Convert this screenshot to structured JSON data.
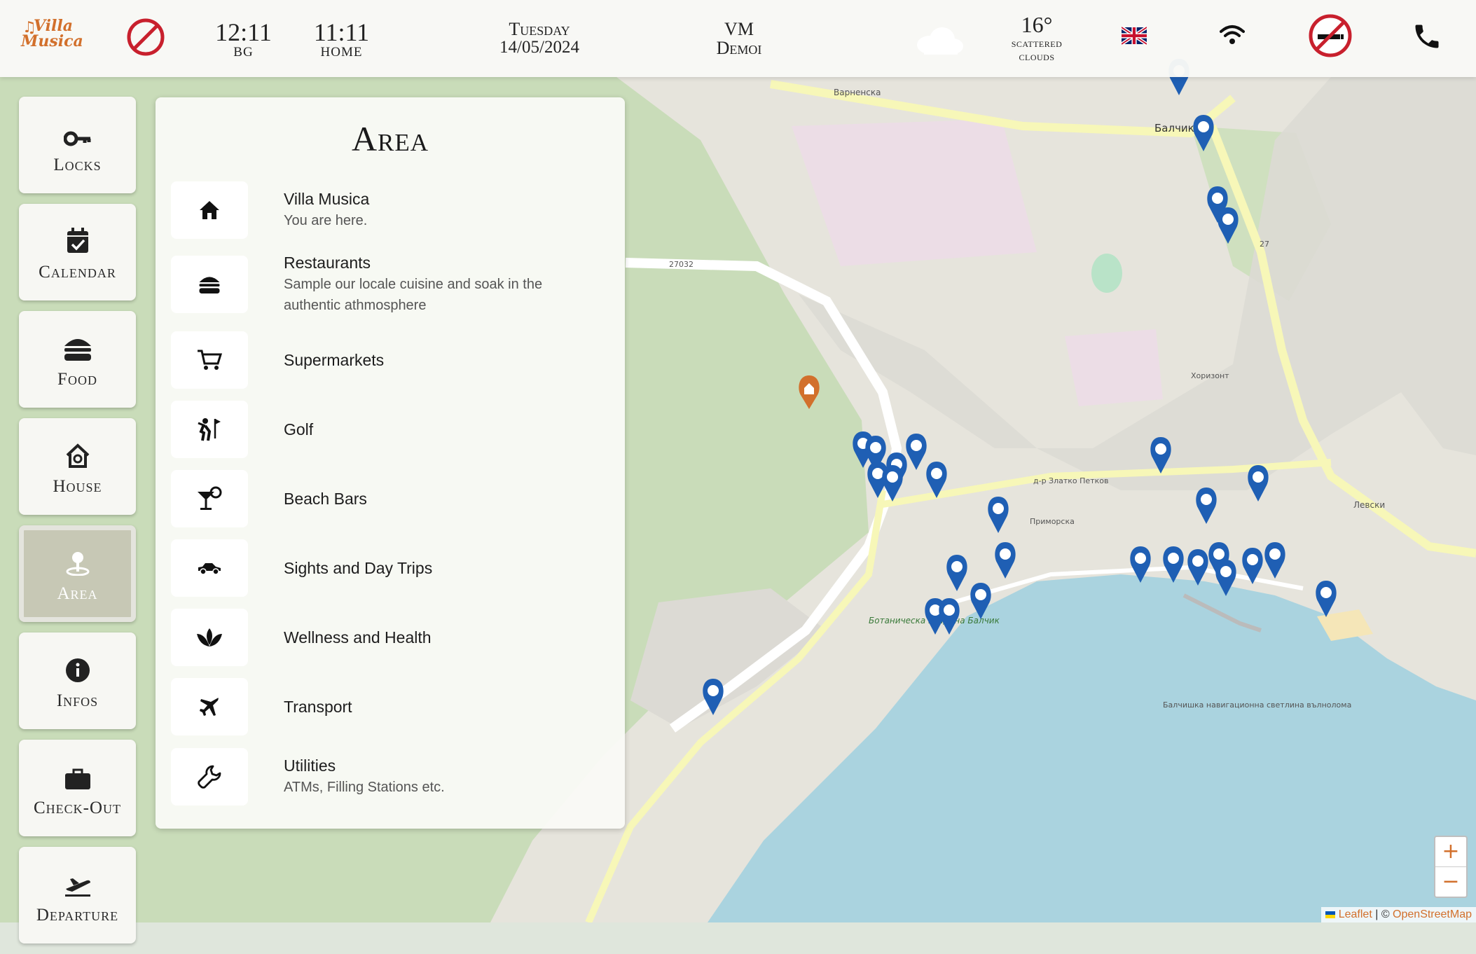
{
  "header": {
    "logo_line1": "Villa",
    "logo_line2": "Musica",
    "time_bg": "12:11",
    "time_bg_label": "BG",
    "time_home": "11:11",
    "time_home_label": "HOME",
    "day": "Tuesday",
    "date": "14/05/2024",
    "guest_line1": "VM",
    "guest_line2": "Demoi",
    "temperature": "16°",
    "weather_line1": "scattered",
    "weather_line2": "clouds",
    "icons": [
      "no-entry-icon",
      "cloud-icon",
      "uk-flag-icon",
      "wifi-icon",
      "no-smoking-icon",
      "phone-icon"
    ],
    "accent": "#d2702c",
    "alert_red": "#c8202d"
  },
  "sidebar": {
    "items": [
      {
        "label": "Locks",
        "icon": "key-icon"
      },
      {
        "label": "Calendar",
        "icon": "calendar-check-icon"
      },
      {
        "label": "Food",
        "icon": "burger-icon"
      },
      {
        "label": "House",
        "icon": "house-gear-icon"
      },
      {
        "label": "Area",
        "icon": "location-pin-icon",
        "active": true
      },
      {
        "label": "Infos",
        "icon": "info-icon"
      },
      {
        "label": "Check-Out",
        "icon": "briefcase-icon"
      },
      {
        "label": "Departure",
        "icon": "plane-departure-icon"
      }
    ]
  },
  "area": {
    "title": "Area",
    "categories": [
      {
        "name": "Villa Musica",
        "desc": "You are here.",
        "icon": "home-icon"
      },
      {
        "name": "Restaurants",
        "desc": "Sample our locale cuisine and soak in the authentic athmosphere",
        "icon": "burger-icon"
      },
      {
        "name": "Supermarkets",
        "desc": "",
        "icon": "cart-icon"
      },
      {
        "name": "Golf",
        "desc": "",
        "icon": "golf-icon"
      },
      {
        "name": "Beach Bars",
        "desc": "",
        "icon": "cocktail-icon"
      },
      {
        "name": "Sights and Day Trips",
        "desc": "",
        "icon": "car-icon"
      },
      {
        "name": "Wellness and Health",
        "desc": "",
        "icon": "lotus-icon"
      },
      {
        "name": "Transport",
        "desc": "",
        "icon": "plane-icon"
      },
      {
        "name": "Utilities",
        "desc": "ATMs, Filling Stations etc.",
        "icon": "wrench-icon"
      }
    ]
  },
  "map": {
    "zoom_in": "+",
    "zoom_out": "−",
    "attribution_leaflet": "Leaflet",
    "attribution_sep": " | © ",
    "attribution_osm": "OpenStreetMap",
    "labels": {
      "balchik": "Балчик",
      "varnenska": "Варненска",
      "road_27032": "27032",
      "road_27": "27",
      "horizont": "Хоризонт",
      "levski": "Левски",
      "botanical_garden": "Ботаническа градина Балчик",
      "lighthouse": "Балчишка навигационна светлина вълнолома",
      "primorska": "Приморска",
      "zlatko_petkov": "д-р Златко Петков"
    },
    "pin_color": "#1f5fb4",
    "home_pin_color": "#d2702c",
    "sea_color": "#aad3df"
  }
}
